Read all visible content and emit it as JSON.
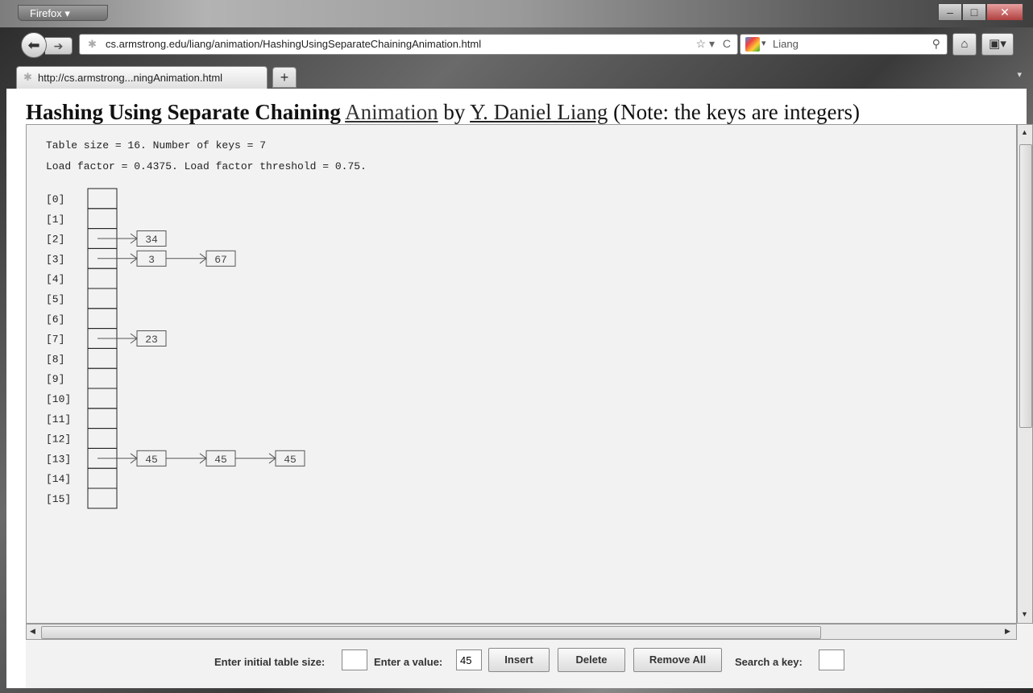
{
  "browser": {
    "app_menu_label": "Firefox",
    "url": "cs.armstrong.edu/liang/animation/HashingUsingSeparateChainingAnimation.html",
    "search_value": "Liang",
    "tab_title": "http://cs.armstrong...ningAnimation.html",
    "new_tab_label": "+"
  },
  "page": {
    "heading_bold": "Hashing Using Separate Chaining",
    "heading_link": "Animation",
    "heading_by": "by",
    "heading_author": "Y. Daniel Liang",
    "heading_note": "(Note: the keys are integers)"
  },
  "applet": {
    "info_line1": "Table size = 16. Number of keys = 7",
    "info_line2": "Load factor = 0.4375. Load factor threshold = 0.75.",
    "slots": [
      "[0]",
      "[1]",
      "[2]",
      "[3]",
      "[4]",
      "[5]",
      "[6]",
      "[7]",
      "[8]",
      "[9]",
      "[10]",
      "[11]",
      "[12]",
      "[13]",
      "[14]",
      "[15]"
    ],
    "chains": [
      {
        "slot": 2,
        "keys": [
          "34"
        ]
      },
      {
        "slot": 3,
        "keys": [
          "3",
          "67"
        ]
      },
      {
        "slot": 7,
        "keys": [
          "23"
        ]
      },
      {
        "slot": 13,
        "keys": [
          "45",
          "45",
          "45"
        ]
      }
    ]
  },
  "controls": {
    "table_size_label": "Enter initial table size:",
    "table_size_value": "",
    "value_label": "Enter a value:",
    "value_value": "45",
    "insert_label": "Insert",
    "delete_label": "Delete",
    "remove_all_label": "Remove All",
    "search_label": "Search a key:",
    "search_value": ""
  }
}
